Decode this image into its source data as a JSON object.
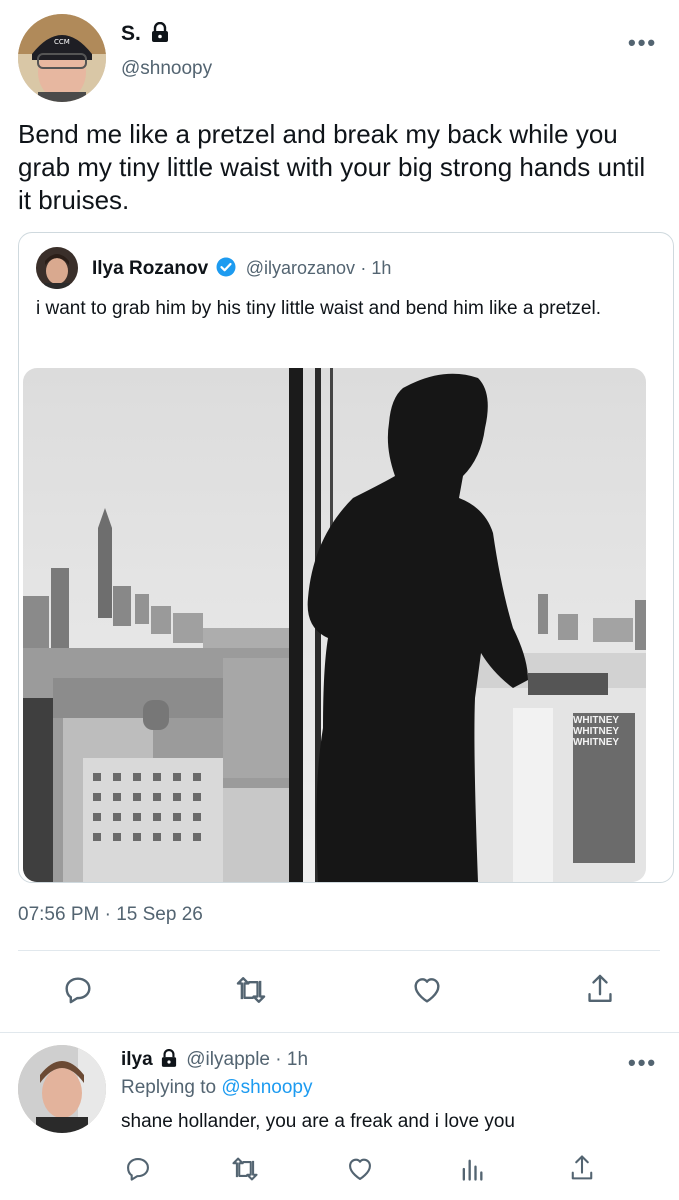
{
  "main_tweet": {
    "author_name": "S.",
    "author_handle": "@shnoopy",
    "text": "Bend me like a pretzel and break my back while you grab my tiny little waist with your big strong hands until it bruises.",
    "more_label": "•••",
    "timestamp": "07:56 PM · 15 Sep 26"
  },
  "quoted_tweet": {
    "author_name": "Ilya Rozanov",
    "author_handle": "@ilyarozanov",
    "time_ago": "· 1h",
    "text": "i want to grab him by his tiny little waist and bend him like a pretzel.",
    "photo_sign_lines": [
      "WHITNEY",
      "WHITNEY",
      "WHITNEY"
    ]
  },
  "actions": {
    "icons": [
      "reply-icon",
      "retweet-icon",
      "like-icon",
      "share-icon"
    ]
  },
  "reply": {
    "author_name": "ilya",
    "author_handle": "@ilyapple",
    "time_ago": "· 1h",
    "replying_to_label": "Replying to",
    "replying_to_handle": "@shnoopy",
    "text": "shane hollander, you are a freak and i love you",
    "more_label": "•••",
    "icons": [
      "reply-icon",
      "retweet-icon",
      "like-icon",
      "analytics-icon",
      "share-icon"
    ]
  },
  "colors": {
    "accent": "#1d9bf0",
    "secondary_text": "#536471",
    "border": "#cfd9de"
  }
}
